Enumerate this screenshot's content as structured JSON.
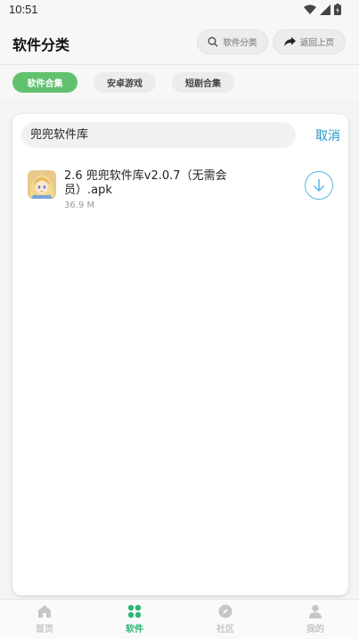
{
  "status_bar": {
    "time": "10:51"
  },
  "header": {
    "title": "软件分类",
    "search_label": "软件分类",
    "back_label": "返回上页"
  },
  "tabs": [
    {
      "label": "软件合集",
      "active": true
    },
    {
      "label": "安卓游戏",
      "active": false
    },
    {
      "label": "短剧合集",
      "active": false
    }
  ],
  "search": {
    "value": "兜兜软件库",
    "cancel_label": "取消"
  },
  "results": [
    {
      "title": "2.6 兜兜软件库v2.0.7（无需会员）.apk",
      "size": "36.9 M"
    }
  ],
  "bottom_nav": [
    {
      "label": "首页",
      "icon": "home-icon",
      "active": false
    },
    {
      "label": "软件",
      "icon": "grid-icon",
      "active": true
    },
    {
      "label": "社区",
      "icon": "compass-icon",
      "active": false
    },
    {
      "label": "我的",
      "icon": "user-icon",
      "active": false
    }
  ],
  "colors": {
    "accent_green": "#62c16f",
    "nav_active": "#2bb673",
    "link_blue": "#2196c8"
  }
}
